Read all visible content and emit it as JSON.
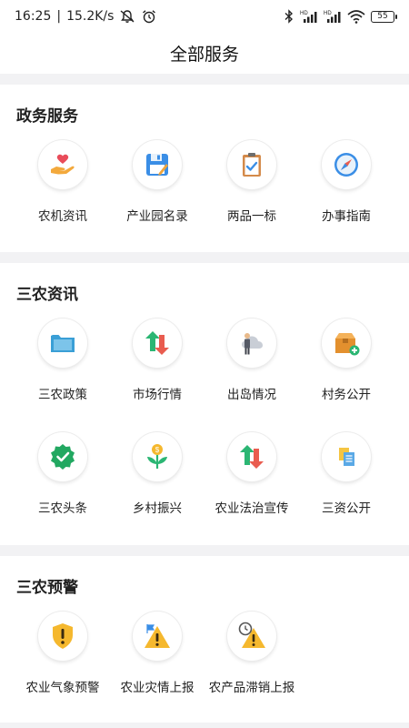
{
  "status_bar": {
    "time": "16:25",
    "speed": "15.2K/s",
    "battery": "55",
    "icons": [
      "bell-off-icon",
      "alarm-icon",
      "bluetooth-icon",
      "signal-hd-icon",
      "signal-hd-icon",
      "wifi-icon",
      "battery-icon"
    ]
  },
  "header": {
    "title": "全部服务"
  },
  "sections": [
    {
      "title": "政务服务",
      "items": [
        {
          "label": "农机资讯",
          "icon": "heart-hand-icon"
        },
        {
          "label": "产业园名录",
          "icon": "save-disk-icon"
        },
        {
          "label": "两品一标",
          "icon": "clipboard-check-icon"
        },
        {
          "label": "办事指南",
          "icon": "compass-icon"
        }
      ]
    },
    {
      "title": "三农资讯",
      "items": [
        {
          "label": "三农政策",
          "icon": "folder-icon"
        },
        {
          "label": "市场行情",
          "icon": "up-down-arrows-icon"
        },
        {
          "label": "出岛情况",
          "icon": "person-cloud-icon"
        },
        {
          "label": "村务公开",
          "icon": "box-add-icon"
        },
        {
          "label": "三农头条",
          "icon": "verified-badge-icon"
        },
        {
          "label": "乡村振兴",
          "icon": "sprout-coin-icon"
        },
        {
          "label": "农业法治宣传",
          "icon": "up-down-arrows-icon"
        },
        {
          "label": "三资公开",
          "icon": "documents-icon"
        }
      ]
    },
    {
      "title": "三农预警",
      "items": [
        {
          "label": "农业气象预警",
          "icon": "shield-alert-icon"
        },
        {
          "label": "农业灾情上报",
          "icon": "flag-warning-icon"
        },
        {
          "label": "农产品滞销上报",
          "icon": "clock-warning-icon"
        }
      ]
    }
  ],
  "colors": {
    "divider": "#f2f2f4",
    "accent_green": "#2bb673",
    "accent_red": "#e95c4f",
    "accent_orange": "#f0a43a",
    "accent_blue": "#3a8ee6"
  }
}
